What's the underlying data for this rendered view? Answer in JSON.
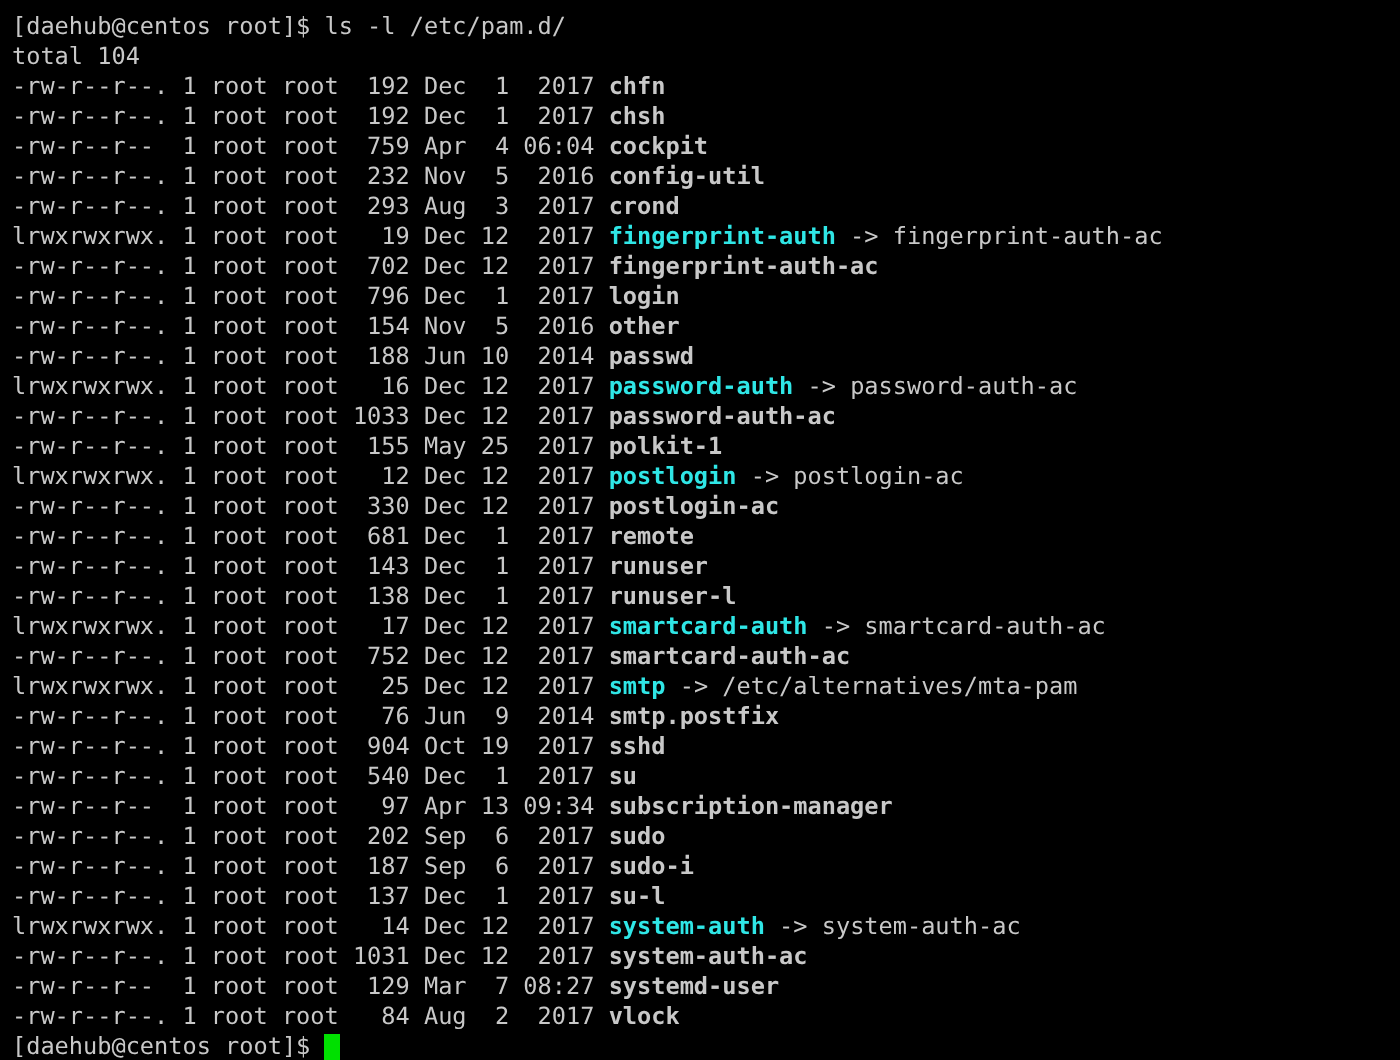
{
  "terminal": {
    "command_line": "[daehub@centos root]$ ls -l /etc/pam.d/",
    "total": "total 104",
    "rows": [
      {
        "kind": "file",
        "info": "-rw-r--r--. 1 root root  192 Dec  1  2017",
        "name": "chfn"
      },
      {
        "kind": "file",
        "info": "-rw-r--r--. 1 root root  192 Dec  1  2017",
        "name": "chsh"
      },
      {
        "kind": "file",
        "info": "-rw-r--r--  1 root root  759 Apr  4 06:04",
        "name": "cockpit"
      },
      {
        "kind": "file",
        "info": "-rw-r--r--. 1 root root  232 Nov  5  2016",
        "name": "config-util"
      },
      {
        "kind": "file",
        "info": "-rw-r--r--. 1 root root  293 Aug  3  2017",
        "name": "crond"
      },
      {
        "kind": "symlink",
        "info": "lrwxrwxrwx. 1 root root   19 Dec 12  2017",
        "name": "fingerprint-auth",
        "target": "-> fingerprint-auth-ac"
      },
      {
        "kind": "file",
        "info": "-rw-r--r--. 1 root root  702 Dec 12  2017",
        "name": "fingerprint-auth-ac"
      },
      {
        "kind": "file",
        "info": "-rw-r--r--. 1 root root  796 Dec  1  2017",
        "name": "login"
      },
      {
        "kind": "file",
        "info": "-rw-r--r--. 1 root root  154 Nov  5  2016",
        "name": "other"
      },
      {
        "kind": "file",
        "info": "-rw-r--r--. 1 root root  188 Jun 10  2014",
        "name": "passwd"
      },
      {
        "kind": "symlink",
        "info": "lrwxrwxrwx. 1 root root   16 Dec 12  2017",
        "name": "password-auth",
        "target": "-> password-auth-ac"
      },
      {
        "kind": "file",
        "info": "-rw-r--r--. 1 root root 1033 Dec 12  2017",
        "name": "password-auth-ac"
      },
      {
        "kind": "file",
        "info": "-rw-r--r--. 1 root root  155 May 25  2017",
        "name": "polkit-1"
      },
      {
        "kind": "symlink",
        "info": "lrwxrwxrwx. 1 root root   12 Dec 12  2017",
        "name": "postlogin",
        "target": "-> postlogin-ac"
      },
      {
        "kind": "file",
        "info": "-rw-r--r--. 1 root root  330 Dec 12  2017",
        "name": "postlogin-ac"
      },
      {
        "kind": "file",
        "info": "-rw-r--r--. 1 root root  681 Dec  1  2017",
        "name": "remote"
      },
      {
        "kind": "file",
        "info": "-rw-r--r--. 1 root root  143 Dec  1  2017",
        "name": "runuser"
      },
      {
        "kind": "file",
        "info": "-rw-r--r--. 1 root root  138 Dec  1  2017",
        "name": "runuser-l"
      },
      {
        "kind": "symlink",
        "info": "lrwxrwxrwx. 1 root root   17 Dec 12  2017",
        "name": "smartcard-auth",
        "target": "-> smartcard-auth-ac"
      },
      {
        "kind": "file",
        "info": "-rw-r--r--. 1 root root  752 Dec 12  2017",
        "name": "smartcard-auth-ac"
      },
      {
        "kind": "symlink",
        "info": "lrwxrwxrwx. 1 root root   25 Dec 12  2017",
        "name": "smtp",
        "target": "-> /etc/alternatives/mta-pam"
      },
      {
        "kind": "file",
        "info": "-rw-r--r--. 1 root root   76 Jun  9  2014",
        "name": "smtp.postfix"
      },
      {
        "kind": "file",
        "info": "-rw-r--r--. 1 root root  904 Oct 19  2017",
        "name": "sshd"
      },
      {
        "kind": "file",
        "info": "-rw-r--r--. 1 root root  540 Dec  1  2017",
        "name": "su"
      },
      {
        "kind": "file",
        "info": "-rw-r--r--  1 root root   97 Apr 13 09:34",
        "name": "subscription-manager"
      },
      {
        "kind": "file",
        "info": "-rw-r--r--. 1 root root  202 Sep  6  2017",
        "name": "sudo"
      },
      {
        "kind": "file",
        "info": "-rw-r--r--. 1 root root  187 Sep  6  2017",
        "name": "sudo-i"
      },
      {
        "kind": "file",
        "info": "-rw-r--r--. 1 root root  137 Dec  1  2017",
        "name": "su-l"
      },
      {
        "kind": "symlink",
        "info": "lrwxrwxrwx. 1 root root   14 Dec 12  2017",
        "name": "system-auth",
        "target": "-> system-auth-ac"
      },
      {
        "kind": "file",
        "info": "-rw-r--r--. 1 root root 1031 Dec 12  2017",
        "name": "system-auth-ac"
      },
      {
        "kind": "file",
        "info": "-rw-r--r--  1 root root  129 Mar  7 08:27",
        "name": "systemd-user"
      },
      {
        "kind": "file",
        "info": "-rw-r--r--. 1 root root   84 Aug  2  2017",
        "name": "vlock"
      }
    ],
    "prompt": "[daehub@centos root]$"
  }
}
